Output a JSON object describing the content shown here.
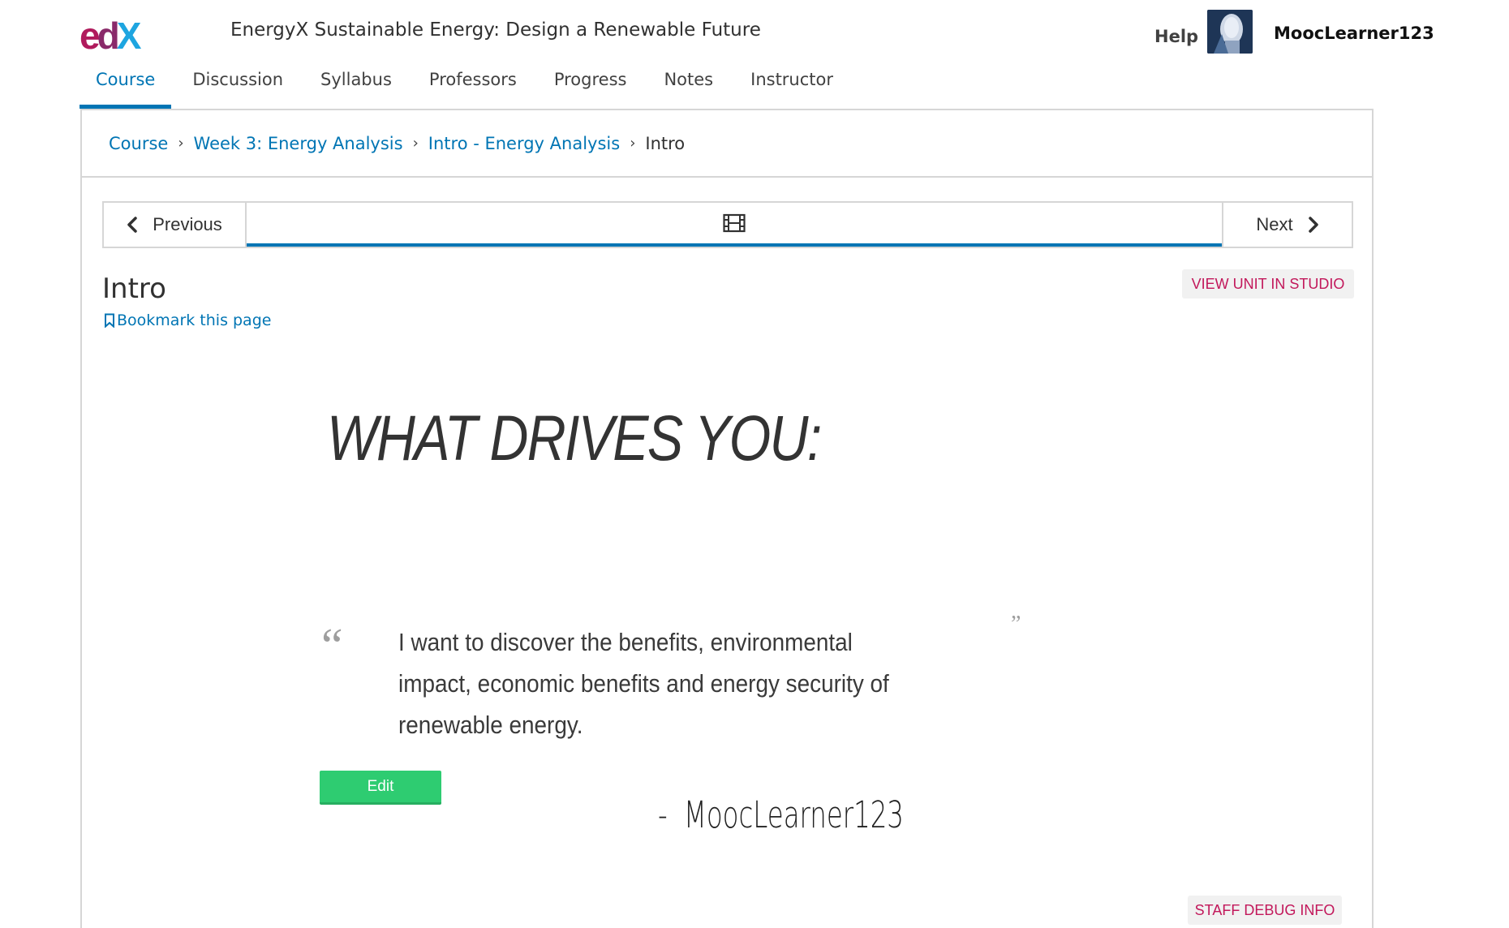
{
  "header": {
    "logo_text": "edX",
    "course_title": "EnergyX Sustainable Energy: Design a Renewable Future",
    "help_label": "Help",
    "username": "MoocLearner123",
    "avatar_icon": "user-avatar"
  },
  "nav": {
    "tabs": [
      {
        "label": "Course",
        "active": true
      },
      {
        "label": "Discussion",
        "active": false
      },
      {
        "label": "Syllabus",
        "active": false
      },
      {
        "label": "Professors",
        "active": false
      },
      {
        "label": "Progress",
        "active": false
      },
      {
        "label": "Notes",
        "active": false
      },
      {
        "label": "Instructor",
        "active": false
      }
    ]
  },
  "breadcrumbs": {
    "items": [
      "Course",
      "Week 3: Energy Analysis",
      "Intro - Energy Analysis"
    ],
    "current": "Intro",
    "separator": ">"
  },
  "sequence": {
    "previous_label": "Previous",
    "next_label": "Next",
    "unit_icon": "video-icon"
  },
  "unit": {
    "title": "Intro",
    "bookmark_label": "Bookmark this page",
    "studio_label": "VIEW UNIT IN STUDIO",
    "debug_label": "STAFF DEBUG INFO"
  },
  "content": {
    "heading": "WHAT DRIVES YOU:",
    "quote": "I want to discover the benefits, environmental impact, economic benefits and energy security of renewable energy.",
    "author_dash": "-",
    "author": "MoocLearner123",
    "edit_label": "Edit"
  },
  "colors": {
    "link_blue": "#0075b4",
    "studio_pink": "#c2185b",
    "edit_green": "#2ecc71",
    "logo_magenta": "#b01a5c",
    "logo_blue": "#1ea5e0"
  }
}
